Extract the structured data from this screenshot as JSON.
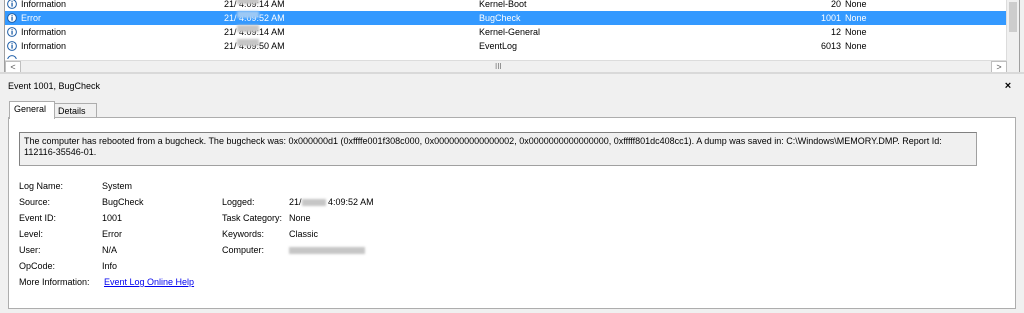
{
  "event_list": {
    "rows": [
      {
        "level": "Information",
        "date_prefix": "21/",
        "time": "4:09:14 AM",
        "source": "Kernel-Boot",
        "event_id": "20",
        "task": "None",
        "selected": false
      },
      {
        "level": "Error",
        "date_prefix": "21/",
        "time": "4:09:52 AM",
        "source": "BugCheck",
        "event_id": "1001",
        "task": "None",
        "selected": true
      },
      {
        "level": "Information",
        "date_prefix": "21/",
        "time": "4:09:14 AM",
        "source": "Kernel-General",
        "event_id": "12",
        "task": "None",
        "selected": false
      },
      {
        "level": "Information",
        "date_prefix": "21/",
        "time": "4:09:50 AM",
        "source": "EventLog",
        "event_id": "6013",
        "task": "None",
        "selected": false
      }
    ],
    "scroll_grip": "III",
    "scroll_left": "<",
    "scroll_right": ">"
  },
  "detail": {
    "title": "Event 1001, BugCheck",
    "close": "×",
    "tabs": {
      "general": "General",
      "details": "Details"
    },
    "message": "The computer has rebooted from a bugcheck.  The bugcheck was: 0x000000d1 (0xffffe001f308c000, 0x0000000000000002, 0x0000000000000000, 0xfffff801dc408cc1). A dump was saved in: C:\\Windows\\MEMORY.DMP. Report Id: 112116-35546-01.",
    "log_name_label": "Log Name:",
    "log_name": "System",
    "source_label": "Source:",
    "source": "BugCheck",
    "event_id_label": "Event ID:",
    "event_id": "1001",
    "level_label": "Level:",
    "level": "Error",
    "user_label": "User:",
    "user": "N/A",
    "opcode_label": "OpCode:",
    "opcode": "Info",
    "more_info_label": "More Information:",
    "more_info_link": "Event Log Online Help",
    "logged_label": "Logged:",
    "logged_prefix": "21/",
    "logged_time": "4:09:52 AM",
    "task_category_label": "Task Category:",
    "task_category": "None",
    "keywords_label": "Keywords:",
    "keywords": "Classic",
    "computer_label": "Computer:"
  },
  "colors": {
    "selection": "#3399ff",
    "info_icon": "#1f5fa8",
    "link": "#0000ee"
  }
}
